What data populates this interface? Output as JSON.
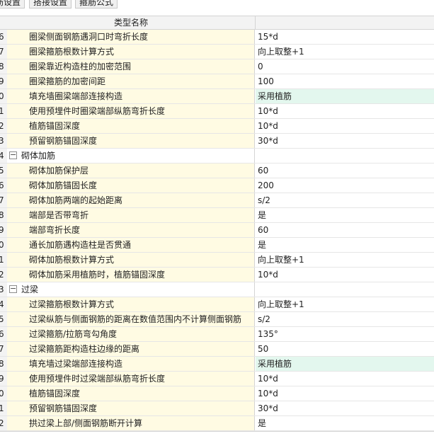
{
  "tabs": [
    "筋设置",
    "搭接设置",
    "箍筋公式"
  ],
  "header": {
    "name_col": "类型名称"
  },
  "rows": [
    {
      "num": "6",
      "name": "圈梁侧面钢筋遇洞口时弯折长度",
      "value": "15*d",
      "group": false,
      "highlight": false
    },
    {
      "num": "7",
      "name": "圈梁箍筋根数计算方式",
      "value": "向上取整+1",
      "group": false,
      "highlight": false
    },
    {
      "num": "8",
      "name": "圈梁靠近构造柱的加密范围",
      "value": "0",
      "group": false,
      "highlight": false
    },
    {
      "num": "9",
      "name": "圈梁箍筋的加密间距",
      "value": "100",
      "group": false,
      "highlight": false
    },
    {
      "num": "0",
      "name": "填充墙圈梁端部连接构造",
      "value": "采用植筋",
      "group": false,
      "highlight": true
    },
    {
      "num": "1",
      "name": "使用预埋件时圈梁端部纵筋弯折长度",
      "value": "10*d",
      "group": false,
      "highlight": false
    },
    {
      "num": "2",
      "name": "植筋锚固深度",
      "value": "10*d",
      "group": false,
      "highlight": false
    },
    {
      "num": "3",
      "name": "预留钢筋锚固深度",
      "value": "30*d",
      "group": false,
      "highlight": false
    },
    {
      "num": "4",
      "name": "砌体加筋",
      "value": "",
      "group": true,
      "highlight": false
    },
    {
      "num": "5",
      "name": "砌体加筋保护层",
      "value": "60",
      "group": false,
      "highlight": false
    },
    {
      "num": "6",
      "name": "砌体加筋锚固长度",
      "value": "200",
      "group": false,
      "highlight": false
    },
    {
      "num": "7",
      "name": "砌体加筋两端的起始距离",
      "value": "s/2",
      "group": false,
      "highlight": false
    },
    {
      "num": "8",
      "name": "端部是否带弯折",
      "value": "是",
      "group": false,
      "highlight": false
    },
    {
      "num": "9",
      "name": "端部弯折长度",
      "value": "60",
      "group": false,
      "highlight": false
    },
    {
      "num": "0",
      "name": "通长加筋遇构造柱是否贯通",
      "value": "是",
      "group": false,
      "highlight": false
    },
    {
      "num": "1",
      "name": "砌体加筋根数计算方式",
      "value": "向上取整+1",
      "group": false,
      "highlight": false
    },
    {
      "num": "2",
      "name": "砌体加筋采用植筋时，植筋锚固深度",
      "value": "10*d",
      "group": false,
      "highlight": false
    },
    {
      "num": "3",
      "name": "过梁",
      "value": "",
      "group": true,
      "highlight": false
    },
    {
      "num": "4",
      "name": "过梁箍筋根数计算方式",
      "value": "向上取整+1",
      "group": false,
      "highlight": false
    },
    {
      "num": "5",
      "name": "过梁纵筋与侧面钢筋的距离在数值范围内不计算侧面钢筋",
      "value": "s/2",
      "group": false,
      "highlight": false
    },
    {
      "num": "6",
      "name": "过梁箍筋/拉筋弯勾角度",
      "value": "135°",
      "group": false,
      "highlight": false
    },
    {
      "num": "7",
      "name": "过梁箍筋距构造柱边缘的距离",
      "value": "50",
      "group": false,
      "highlight": false
    },
    {
      "num": "8",
      "name": "填充墙过梁端部连接构造",
      "value": "采用植筋",
      "group": false,
      "highlight": true
    },
    {
      "num": "9",
      "name": "使用预埋件时过梁端部纵筋弯折长度",
      "value": "10*d",
      "group": false,
      "highlight": false
    },
    {
      "num": "0",
      "name": "植筋锚固深度",
      "value": "10*d",
      "group": false,
      "highlight": false
    },
    {
      "num": "1",
      "name": "预留钢筋锚固深度",
      "value": "30*d",
      "group": false,
      "highlight": false
    },
    {
      "num": "2",
      "name": "拱过梁上部/侧面钢筋断开计算",
      "value": "是",
      "group": false,
      "highlight": false
    }
  ],
  "icons": {
    "group_toggle": "collapse-minus-icon"
  },
  "colors": {
    "name_bg": "#fffbe3",
    "highlight_bg": "#e3f7ee",
    "header_bg": "#f3f3f3"
  }
}
